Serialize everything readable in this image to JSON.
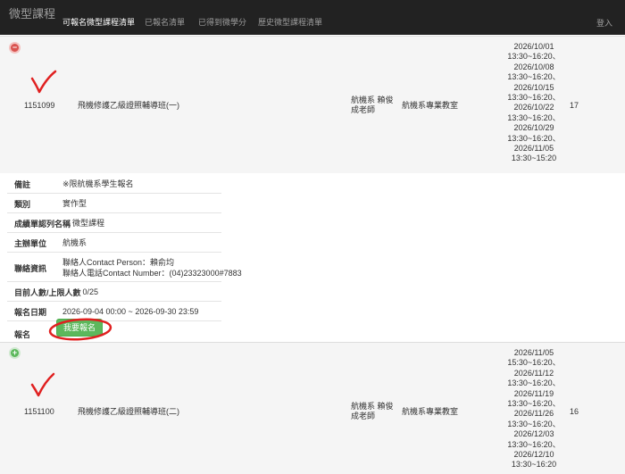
{
  "navbar": {
    "brand": "微型課程",
    "items": [
      {
        "label": "可報名微型課程清單",
        "active": true
      },
      {
        "label": "已報名清單",
        "active": false
      },
      {
        "label": "已得到微學分",
        "active": false
      },
      {
        "label": "歷史微型課程清單",
        "active": false
      }
    ],
    "login": "登入"
  },
  "courses": [
    {
      "toggle_icon": "minus-icon",
      "id": "1151099",
      "name": "飛機修護乙級證照輔導班(一)",
      "teacher": [
        "航機系 賴俊",
        "成老師"
      ],
      "location": "航機系專業教室",
      "dates": [
        "2026/10/01",
        "13:30~16:20、",
        "2026/10/08",
        "13:30~16:20、",
        "2026/10/15",
        "13:30~16:20、",
        "2026/10/22",
        "13:30~16:20、",
        "2026/10/29",
        "13:30~16:20、",
        "2026/11/05",
        "13:30~15:20"
      ],
      "hours": "17"
    },
    {
      "toggle_icon": "plus-icon",
      "id": "1151100",
      "name": "飛機修護乙級證照輔導班(二)",
      "teacher": [
        "航機系 賴俊",
        "成老師"
      ],
      "location": "航機系專業教室",
      "dates": [
        "2026/11/05",
        "15:30~16:20、",
        "2026/11/12",
        "13:30~16:20、",
        "2026/11/19",
        "13:30~16:20、",
        "2026/11/26",
        "13:30~16:20、",
        "2026/12/03",
        "13:30~16:20、",
        "2026/12/10",
        "13:30~16:20"
      ],
      "hours": "16"
    }
  ],
  "details": {
    "remark_label": "備註",
    "remark": "※限航機系學生報名",
    "type_label": "類別",
    "type": "實作型",
    "transcript_label": "成績單認列名稱",
    "transcript": "微型課程",
    "host_label": "主辦單位",
    "host": "航機系",
    "contact_label": "聯絡資訊",
    "contact_person": "聯絡人Contact Person：賴俞均",
    "contact_phone": "聯絡人電話Contact Number：(04)23323000#7883",
    "enroll_label": "目前人數/上限人數",
    "enroll": "0/25",
    "period_label": "報名日期",
    "period": "2026-09-04 00:00 ~ 2026-09-30 23:59",
    "signup_label": "報名",
    "signup_button": "我要報名"
  },
  "colors": {
    "navbar_bg": "#222222",
    "row_bg": "#f5f5f5",
    "button_green": "#5cb85c",
    "minus_red": "#d9534f",
    "annotation_red": "#e02020"
  }
}
